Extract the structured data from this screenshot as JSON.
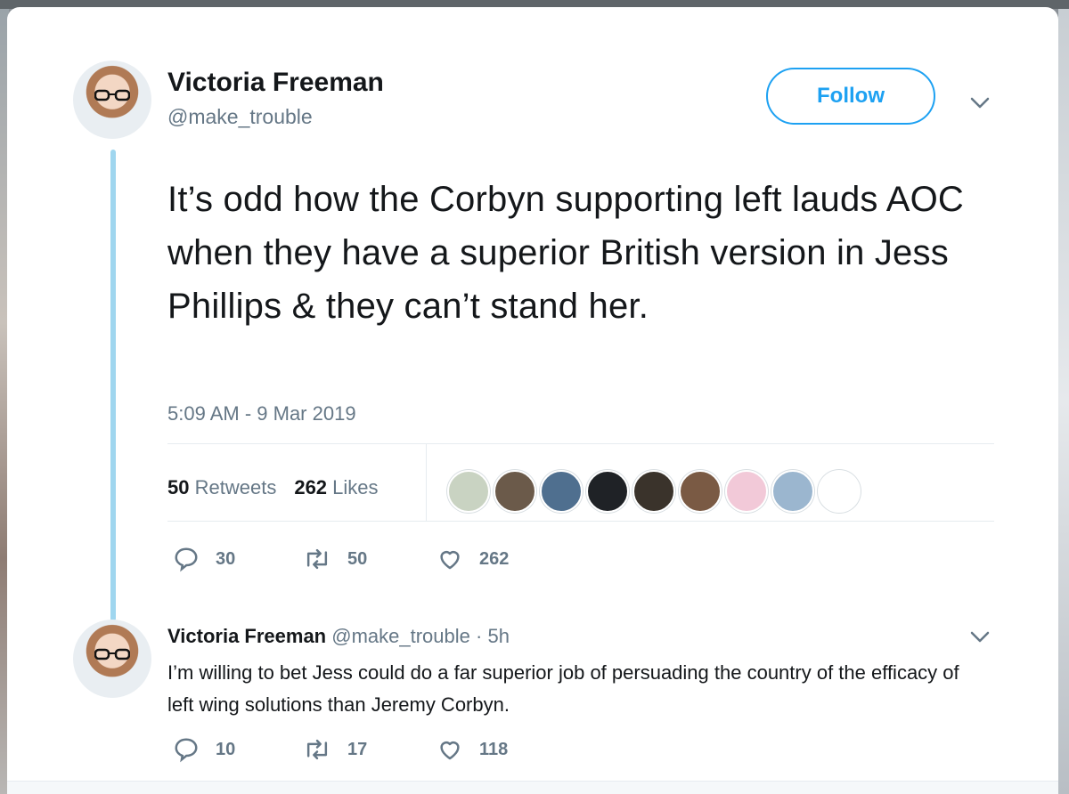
{
  "tweet": {
    "author_name": "Victoria Freeman",
    "author_handle": "@make_trouble",
    "follow_label": "Follow",
    "text": "It’s odd how the Corbyn supporting left lauds AOC when they have a superior British version in Jess Phillips & they can’t stand her.",
    "timestamp": "5:09 AM - 9 Mar 2019",
    "retweets_count": "50",
    "retweets_label": "Retweets",
    "likes_count": "262",
    "likes_label": "Likes",
    "actions": {
      "replies": "30",
      "retweets": "50",
      "likes": "262"
    }
  },
  "reply": {
    "author_name": "Victoria Freeman",
    "author_handle": "@make_trouble",
    "time": "· 5h",
    "text": "I’m willing to bet Jess could do a far superior job of persuading the country of the efficacy of left wing solutions than Jeremy Corbyn.",
    "actions": {
      "replies": "10",
      "retweets": "17",
      "likes": "118"
    }
  },
  "likers_avatars": [
    "#c9d3c2",
    "#6b5a4a",
    "#4f6f8f",
    "#1f2226",
    "#3a332b",
    "#7a5a44",
    "#f2c9d8",
    "#9bb6cf",
    "#ffffff"
  ],
  "colors": {
    "accent": "#1da1f2",
    "thread": "#9fd6ef",
    "muted": "#657786",
    "text": "#14171a"
  },
  "icons": [
    "reply-icon",
    "retweet-icon",
    "heart-icon",
    "chevron-down-icon"
  ]
}
